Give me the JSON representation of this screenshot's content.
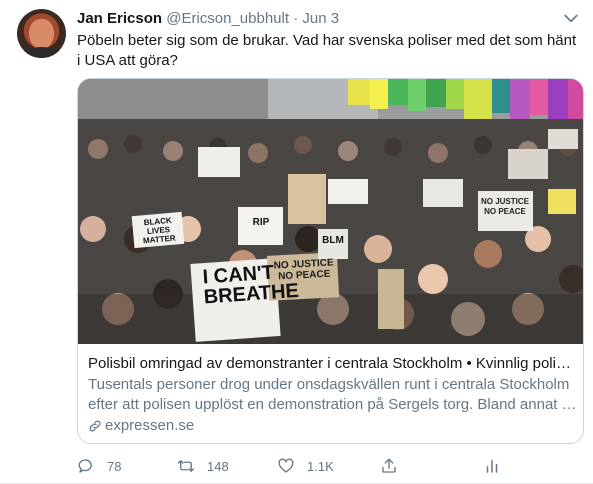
{
  "author": {
    "name": "Jan Ericson",
    "handle": "@Ericson_ubbhult",
    "separator": "·",
    "date": "Jun 3"
  },
  "tweet_text": "Pöbeln beter sig som de brukar. Vad har svenska poliser med det som hänt i USA att göra?",
  "card": {
    "signs": [
      "I CAN'T BREATHE",
      "NO JUSTICE NO PEACE",
      "BLACK LIVES MATTER",
      "BLM",
      "RIP",
      "NO JUSTICE NO PEACE"
    ],
    "title": "Polisbil omringad av demonstranter i centrala Stockholm • Kvinnlig polis…",
    "description": "Tusentals personer drog under onsdagskvällen runt i centrala Stockholm efter att polisen upplöst en demonstration på Sergels torg. Bland annat …",
    "domain": "expressen.se"
  },
  "actions": {
    "replies": "78",
    "retweets": "148",
    "likes": "1.1K"
  },
  "colors": {
    "secondary_text": "#657786",
    "border": "#ccd6dd"
  }
}
